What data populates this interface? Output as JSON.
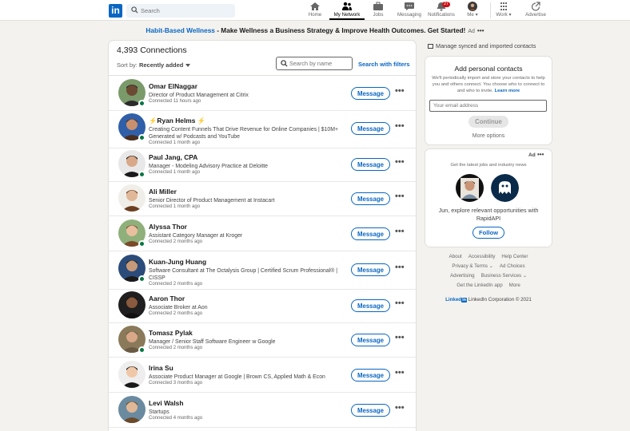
{
  "nav": {
    "logo": "in",
    "search_placeholder": "Search",
    "items": [
      {
        "label": "Home"
      },
      {
        "label": "My Network"
      },
      {
        "label": "Jobs"
      },
      {
        "label": "Messaging"
      },
      {
        "label": "Notifications"
      },
      {
        "label": "Me"
      },
      {
        "label": "Work"
      },
      {
        "label": "Advertise"
      }
    ],
    "notif_badge": "27"
  },
  "promo": {
    "title": "Habit-Based Wellness",
    "body": " - Make Wellness a Business Strategy & Improve Health Outcomes. Get Started!",
    "ad": "Ad",
    "dots": "•••"
  },
  "connections": {
    "count_label": "4,393 Connections",
    "sort_prefix": "Sort by:",
    "sort_value": "Recently added",
    "search_placeholder": "Search by name",
    "filters_link": "Search with filters",
    "message_label": "Message",
    "more_label": "•••",
    "people": [
      {
        "name": "Omar ElNaggar",
        "headline": "Director of Product Management at Citrix",
        "connected": "Connected 11 hours ago"
      },
      {
        "name": "⚡Ryan Helms ⚡",
        "headline": "Creating Content Funnels That Drive Revenue for Online Companies | $10M+ Generated w/ Podcasts and YouTube",
        "connected": "Connected 1 month ago"
      },
      {
        "name": "Paul Jang, CPA",
        "headline": "Manager - Modeling Advisory Practice at Deloitte",
        "connected": "Connected 1 month ago"
      },
      {
        "name": "Ali Miller",
        "headline": "Senior Director of Product Management at Instacart",
        "connected": "Connected 1 month ago"
      },
      {
        "name": "Alyssa Thor",
        "headline": "Assistant Category Manager at Kroger",
        "connected": "Connected 2 months ago"
      },
      {
        "name": "Kuan-Jung Huang",
        "headline": "Software Consultant at The Octalysis Group | Certified Scrum Professional® | CISSP",
        "connected": "Connected 2 months ago"
      },
      {
        "name": "Aaron Thor",
        "headline": "Associate Broker at Aon",
        "connected": "Connected 2 months ago"
      },
      {
        "name": "Tomasz Pylak",
        "headline": "Manager / Senior Staff Software Engineer w Google",
        "connected": "Connected 2 months ago"
      },
      {
        "name": "Irina Su",
        "headline": "Associate Product Manager at Google | Brown CS, Applied Math & Econ",
        "connected": "Connected 3 months ago"
      },
      {
        "name": "Levi Walsh",
        "headline": "Startups",
        "connected": "Connected 4 months ago"
      }
    ]
  },
  "right": {
    "manage_link": "Manage synced and imported contacts",
    "add_title": "Add personal contacts",
    "add_desc": "We'll periodically import and store your contacts to help you and others connect. You choose who to connect to and who to invite.",
    "learn_more": "Learn more",
    "email_placeholder": "Your email address",
    "continue_label": "Continue",
    "more_options": "More options",
    "ad_label": "Ad",
    "ad_dots": "•••",
    "ad_line": "Get the latest jobs and industry news",
    "ad_message": "Jun, explore relevant opportunities with RapidAPI",
    "follow_label": "Follow"
  },
  "footer": {
    "row1": [
      "About",
      "Accessibility",
      "Help Center"
    ],
    "row2": [
      "Privacy & Terms ⌄",
      "Ad Choices"
    ],
    "row3": [
      "Advertising",
      "Business Services ⌄"
    ],
    "row4": [
      "Get the LinkedIn app",
      "More"
    ],
    "copyright_brand": "Linked",
    "copyright_in": "in",
    "copyright": " LinkedIn Corporation © 2021"
  }
}
